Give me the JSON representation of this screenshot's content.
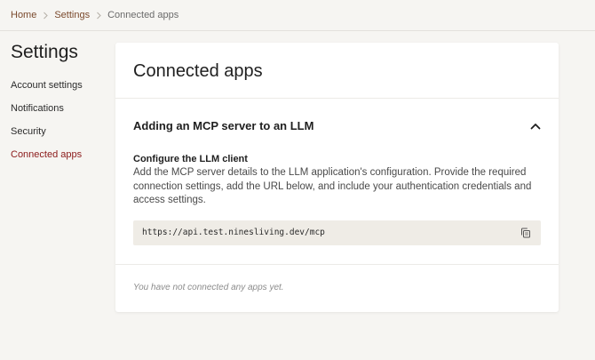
{
  "breadcrumb": {
    "home": "Home",
    "settings": "Settings",
    "current": "Connected apps"
  },
  "sidebar": {
    "title": "Settings",
    "items": [
      {
        "label": "Account settings"
      },
      {
        "label": "Notifications"
      },
      {
        "label": "Security"
      },
      {
        "label": "Connected apps",
        "active": true
      }
    ]
  },
  "main": {
    "title": "Connected apps",
    "accordion": {
      "title": "Adding an MCP server to an LLM",
      "expanded": true,
      "section_title": "Configure the LLM client",
      "description": "Add the MCP server details to the LLM application's configuration. Provide the required connection settings, add the URL below, and include your authentication credentials and access settings.",
      "url": "https://api.test.ninesliving.dev/mcp",
      "copy_icon": "copy-icon"
    },
    "empty_state": "You have not connected any apps yet."
  },
  "colors": {
    "accent": "#8b1a1a",
    "breadcrumb_link": "#7b4a2d",
    "background": "#f6f5f2",
    "code_background": "#efece6"
  }
}
